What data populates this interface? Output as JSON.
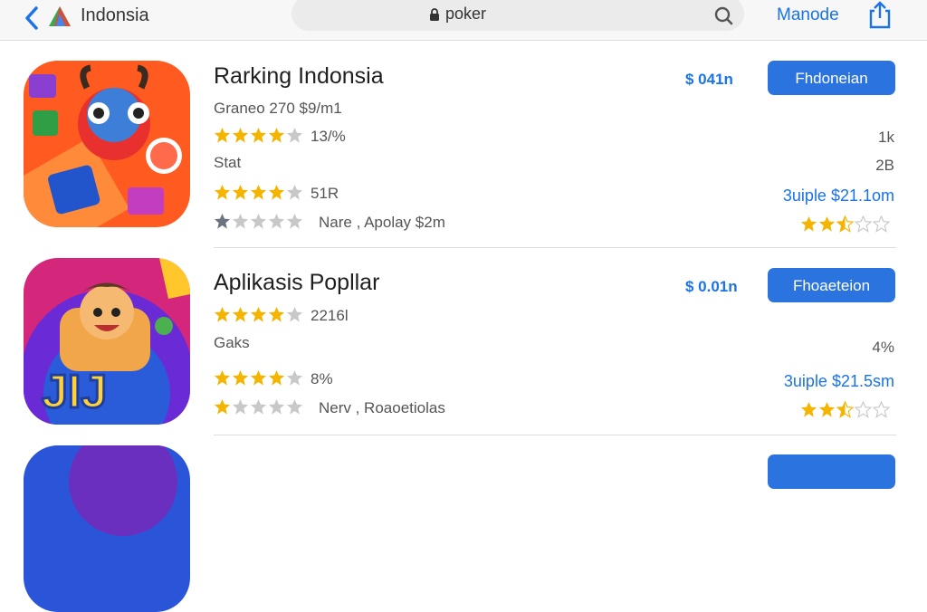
{
  "topbar": {
    "app_name": "Indonsia",
    "url": "poker",
    "right_link": "Manode"
  },
  "apps": [
    {
      "title": "Rarking Indonsia",
      "line1": "Graneo 270   $9/m1",
      "rating_text": "13/%",
      "line2": "Stat",
      "rating2_text": "51R",
      "rating3_text": "Nare  ,  Apolay $2m",
      "price": "$ 041n",
      "button": "Fhdoneian",
      "right1": "1k",
      "right2": "2B",
      "right_blue": "3uiple  $21.1om"
    },
    {
      "title": "Aplikasis Popllar",
      "line1": "",
      "rating_text": "2216l",
      "line2": "Gaks",
      "rating2_text": "8%",
      "rating3_text": "Nerv  ,  Roaoetiolas",
      "price": "$ 0.01n",
      "button": "Fhoaeteion",
      "right1": "",
      "right2": "4%",
      "right_blue": "3uiple  $21.5sm"
    }
  ],
  "colors": {
    "accent": "#1a73e8",
    "button": "#2b74e0",
    "star_gold": "#f5b400",
    "star_empty": "#c8c8c8"
  }
}
